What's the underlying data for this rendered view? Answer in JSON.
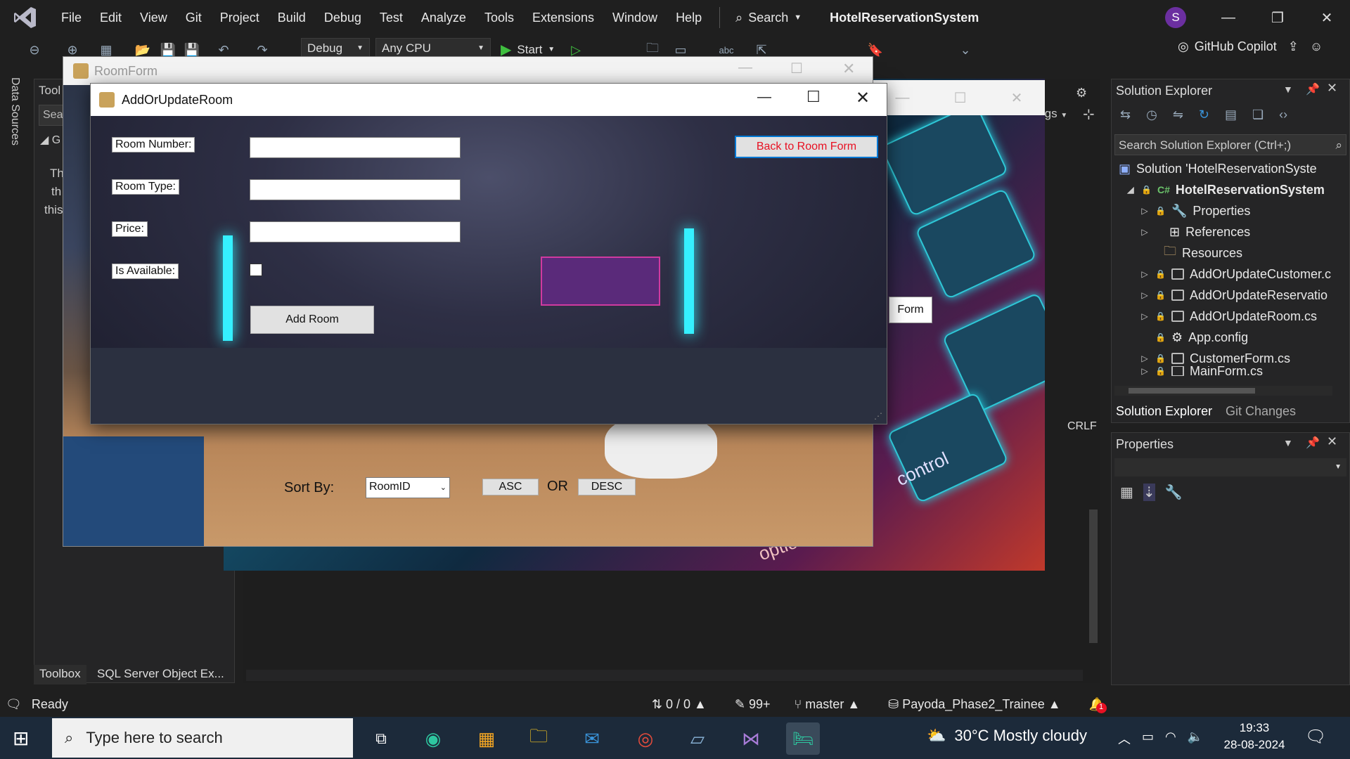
{
  "menu": {
    "items": [
      "File",
      "Edit",
      "View",
      "Git",
      "Project",
      "Build",
      "Debug",
      "Test",
      "Analyze",
      "Tools",
      "Extensions",
      "Window",
      "Help"
    ],
    "search_label": "Search",
    "project_title": "HotelReservationSystem",
    "avatar_initial": "S"
  },
  "toolbar": {
    "config": "Debug",
    "platform": "Any CPU",
    "start_label": "Start",
    "copilot_label": "GitHub Copilot"
  },
  "left": {
    "data_sources": "Data Sources",
    "toolbox_title": "Tool",
    "search_stub": "Sea",
    "group_stub": "G",
    "text1": "Th",
    "text2": "th",
    "text3": "this",
    "toolbox_tab": "Toolbox",
    "sql_tab": "SQL Server Object Ex..."
  },
  "editor": {
    "combo_stub": "rgs",
    "crlf": "CRLF",
    "form_btn_stub": "Form",
    "key_text1": "control",
    "key_text2": "option"
  },
  "room_form": {
    "title": "RoomForm",
    "sort_label": "Sort By:",
    "sort_value": "RoomID",
    "asc_label": "ASC",
    "or_label": "OR",
    "desc_label": "DESC"
  },
  "dialog": {
    "title": "AddOrUpdateRoom",
    "room_number_label": "Room Number:",
    "room_type_label": "Room Type:",
    "price_label": "Price:",
    "available_label": "Is Available:",
    "room_number_value": "",
    "room_type_value": "",
    "price_value": "",
    "is_available": false,
    "back_button": "Back to Room Form",
    "add_button": "Add Room",
    "back_button_color": "#e81123"
  },
  "solution_explorer": {
    "title": "Solution Explorer",
    "search_placeholder": "Search Solution Explorer (Ctrl+;)",
    "solution": "Solution 'HotelReservationSyste",
    "project": "HotelReservationSystem",
    "items": [
      {
        "label": "Properties",
        "icon": "wrench-icon"
      },
      {
        "label": "References",
        "icon": "references-icon"
      },
      {
        "label": "Resources",
        "icon": "folder-icon"
      },
      {
        "label": "AddOrUpdateCustomer.c",
        "icon": "form-icon"
      },
      {
        "label": "AddOrUpdateReservatio",
        "icon": "form-icon"
      },
      {
        "label": "AddOrUpdateRoom.cs",
        "icon": "form-icon"
      },
      {
        "label": "App.config",
        "icon": "config-icon"
      },
      {
        "label": "CustomerForm.cs",
        "icon": "form-icon"
      },
      {
        "label": "MainForm.cs",
        "icon": "form-icon"
      }
    ],
    "tab_solution": "Solution Explorer",
    "tab_git": "Git Changes"
  },
  "properties": {
    "title": "Properties"
  },
  "status": {
    "ready": "Ready",
    "lines": "0 / 0",
    "changes": "99+",
    "branch": "master",
    "repo": "Payoda_Phase2_Trainee",
    "notifications": "1"
  },
  "taskbar": {
    "search_placeholder": "Type here to search",
    "weather": "30°C  Mostly cloudy",
    "time": "19:33",
    "date": "28-08-2024"
  },
  "colors": {
    "accent": "#0078d4",
    "vs_purple": "#6b2fa0",
    "neon_cyan": "#25d0e0"
  }
}
